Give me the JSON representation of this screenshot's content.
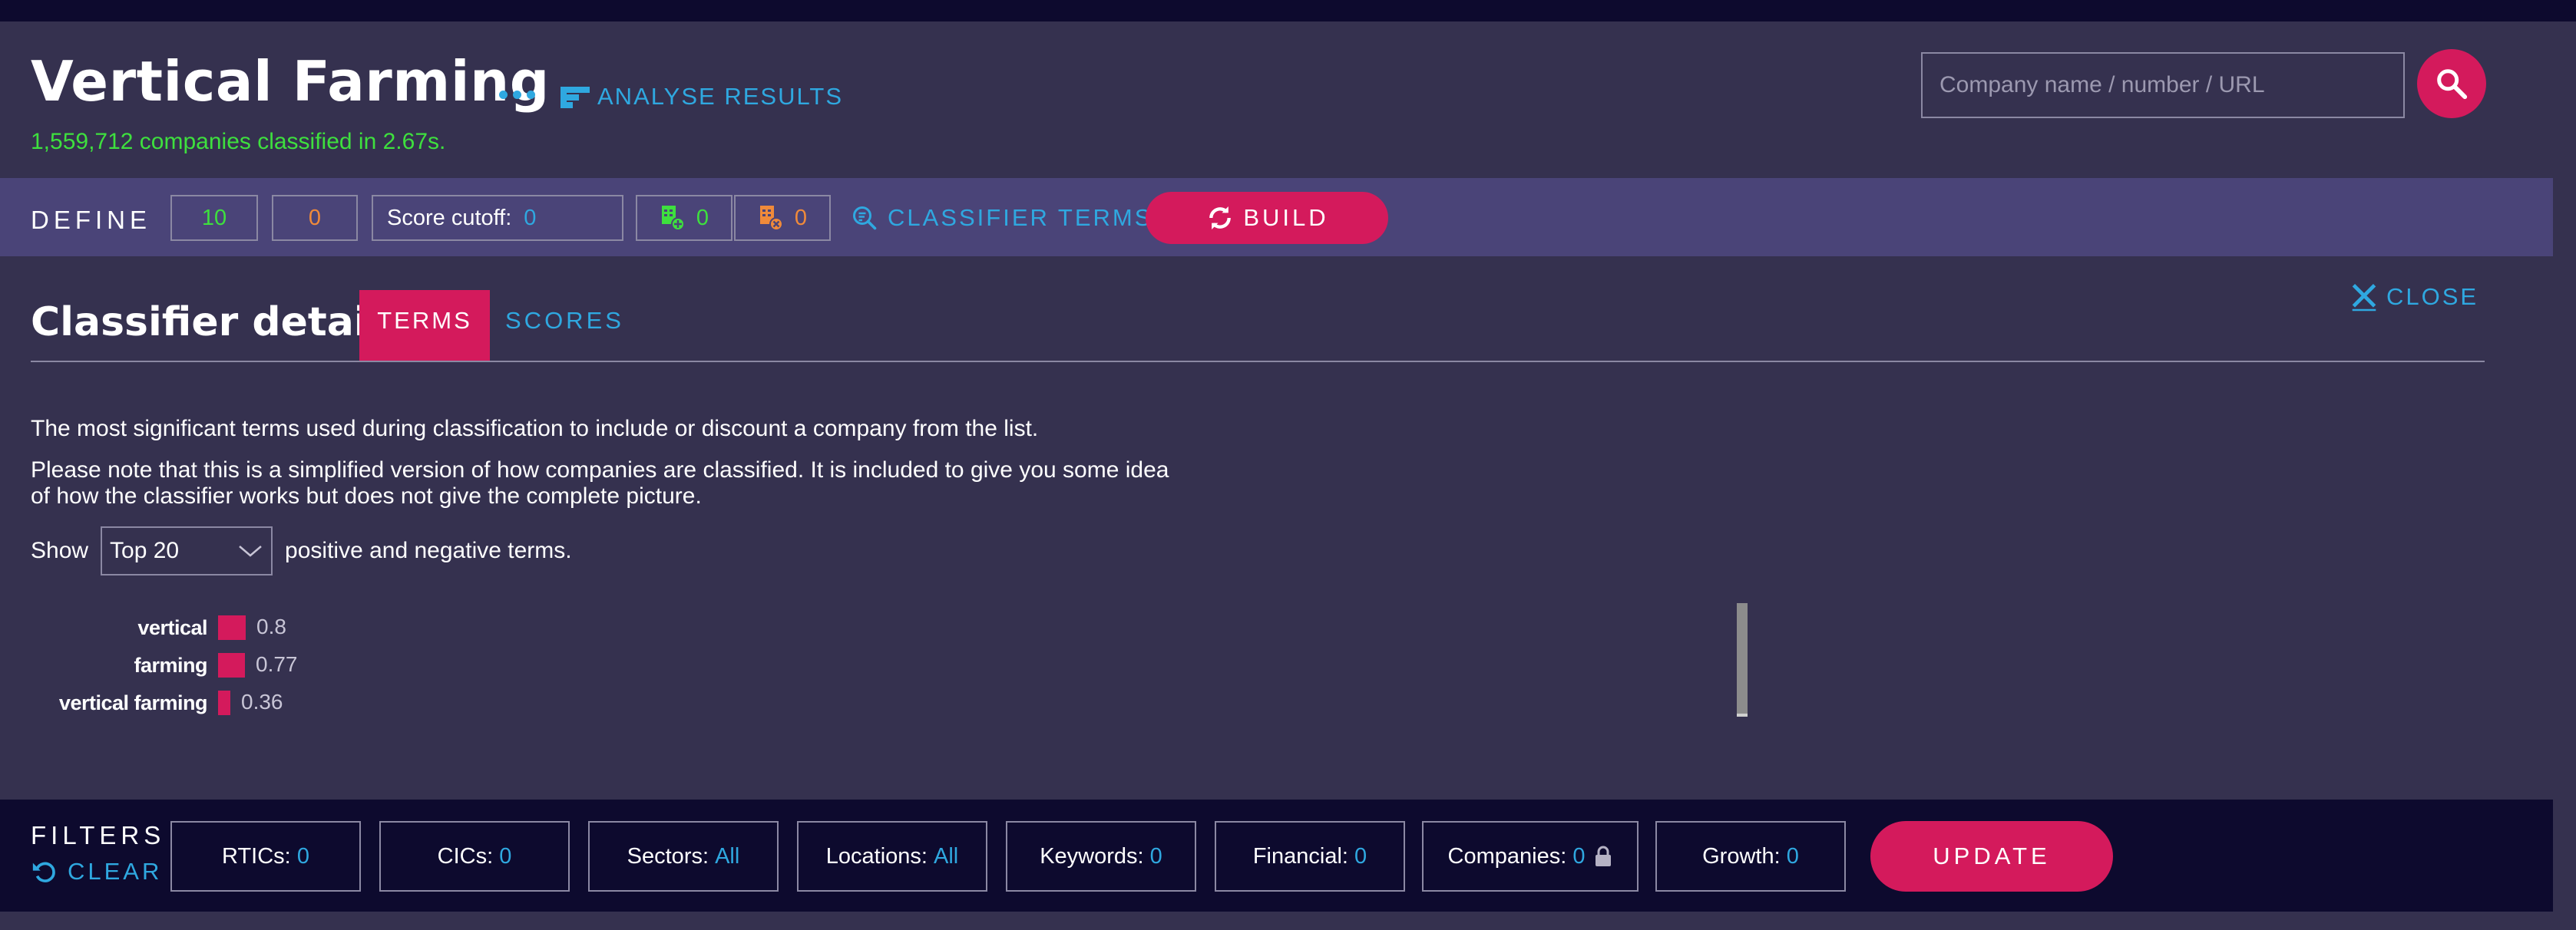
{
  "header": {
    "title": "Vertical Farming",
    "analyse_label": "ANALYSE RESULTS",
    "subtitle": "1,559,712 companies classified in 2.67s.",
    "search_placeholder": "Company name / number / URL"
  },
  "define": {
    "label": "DEFINE",
    "positive_count": "10",
    "negative_count": "0",
    "score_cutoff_label": "Score cutoff:",
    "score_cutoff_value": "0",
    "added_count": "0",
    "removed_count": "0",
    "classifier_terms_label": "CLASSIFIER TERMS",
    "build_label": "BUILD"
  },
  "details": {
    "title": "Classifier details",
    "tab_terms": "TERMS",
    "tab_scores": "SCORES",
    "close_label": "CLOSE",
    "description": "The most significant terms used during classification to include or discount a company from the list.",
    "note_line1": "Please note that this is a simplified version of how companies are classified. It is included to give you some idea",
    "note_line2": "of how the classifier works but does not give the complete picture.",
    "show_label": "Show",
    "show_selected": "Top 20",
    "show_suffix": "positive and negative terms.",
    "terms": [
      {
        "term": "vertical",
        "weight": 0.8,
        "label": "0.8"
      },
      {
        "term": "farming",
        "weight": 0.77,
        "label": "0.77"
      },
      {
        "term": "vertical farming",
        "weight": 0.36,
        "label": "0.36"
      }
    ]
  },
  "filters": {
    "label": "FILTERS",
    "clear_label": "CLEAR",
    "rtics_label": "RTICs:",
    "rtics_value": "0",
    "cics_label": "CICs:",
    "cics_value": "0",
    "sectors_label": "Sectors:",
    "sectors_value": "All",
    "locations_label": "Locations:",
    "locations_value": "All",
    "keywords_label": "Keywords:",
    "keywords_value": "0",
    "financial_label": "Financial:",
    "financial_value": "0",
    "companies_label": "Companies:",
    "companies_value": "0",
    "growth_label": "Growth:",
    "growth_value": "0",
    "update_label": "UPDATE"
  },
  "colors": {
    "background": "#35314f",
    "define_bar": "#4a4478",
    "filters_bar": "#0d0a2e",
    "accent_pink": "#d41a5c",
    "accent_blue": "#2fa8e0",
    "accent_green": "#3ee03e",
    "accent_orange": "#f08a3a"
  },
  "icons": {
    "more": "more-dots-icon",
    "analyse": "bar-chart-icon",
    "search": "search-icon",
    "build": "refresh-icon",
    "close": "close-icon",
    "clear": "undo-icon",
    "lock": "lock-icon"
  }
}
